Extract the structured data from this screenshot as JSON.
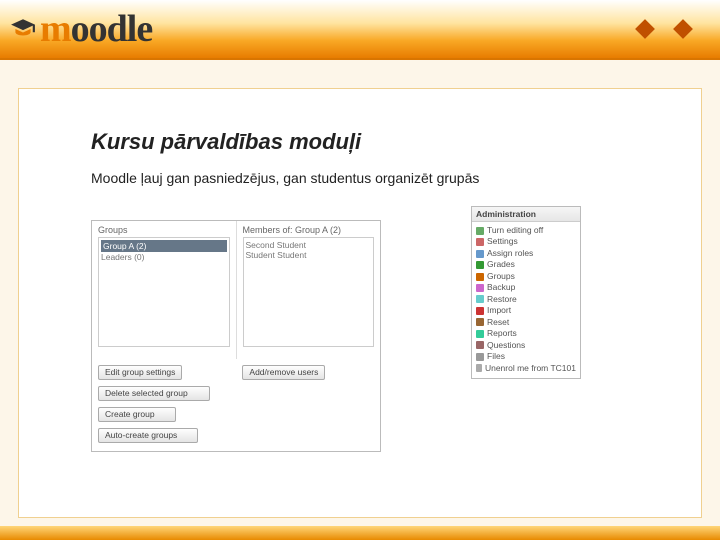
{
  "logo": {
    "brand": "moodle"
  },
  "slide": {
    "title": "Kursu pārvaldības moduļi",
    "body": "Moodle ļauj gan pasniedzējus, gan studentus organizēt grupās"
  },
  "groups_panel": {
    "col1": {
      "header": "Groups",
      "selected": "Group A (2)",
      "row2": "Leaders (0)"
    },
    "col2": {
      "header": "Members of: Group A (2)",
      "row1": "Second Student",
      "row2": "Student Student"
    },
    "buttons": {
      "edit": "Edit group settings",
      "addremove": "Add/remove users",
      "delete": "Delete selected group",
      "create": "Create group",
      "auto": "Auto-create groups"
    }
  },
  "admin": {
    "header": "Administration",
    "items": [
      {
        "label": "Turn editing off",
        "color": "#6a6"
      },
      {
        "label": "Settings",
        "color": "#c66"
      },
      {
        "label": "Assign roles",
        "color": "#69c"
      },
      {
        "label": "Grades",
        "color": "#393"
      },
      {
        "label": "Groups",
        "color": "#c60"
      },
      {
        "label": "Backup",
        "color": "#c6c"
      },
      {
        "label": "Restore",
        "color": "#6cc"
      },
      {
        "label": "Import",
        "color": "#c33"
      },
      {
        "label": "Reset",
        "color": "#963"
      },
      {
        "label": "Reports",
        "color": "#3c9"
      },
      {
        "label": "Questions",
        "color": "#966"
      },
      {
        "label": "Files",
        "color": "#999"
      },
      {
        "label": "Unenrol me from TC101",
        "color": "#aaa"
      }
    ]
  }
}
